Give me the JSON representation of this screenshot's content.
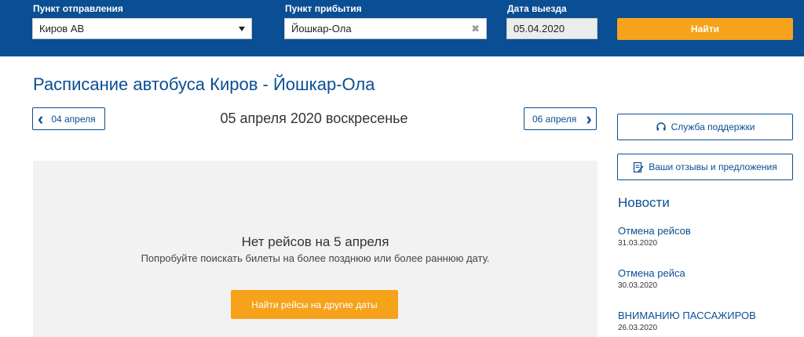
{
  "search": {
    "departure_label": "Пункт отправления",
    "departure_value": "Киров АВ",
    "arrival_label": "Пункт прибытия",
    "arrival_value": "Йошкар-Ола",
    "date_label": "Дата выезда",
    "date_value": "05.04.2020",
    "find_label": "Найти"
  },
  "page": {
    "title": "Расписание автобуса Киров - Йошкар-Ола",
    "prev_date": "04 апреля",
    "next_date": "06 апреля",
    "current_date": "05 апреля 2020 воскресенье"
  },
  "results": {
    "empty_title": "Нет рейсов на 5 апреля",
    "empty_hint": "Попробуйте поискать билеты на более позднюю или более раннюю дату.",
    "other_dates_label": "Найти рейсы на другие даты"
  },
  "sidebar": {
    "support_label": "Служба поддержки",
    "feedback_label": "Ваши отзывы и предложения",
    "news_title": "Новости",
    "news": [
      {
        "title": "Отмена рейсов",
        "date": "31.03.2020"
      },
      {
        "title": "Отмена рейса",
        "date": "30.03.2020"
      },
      {
        "title": "ВНИМАНИЮ ПАССАЖИРОВ",
        "date": "26.03.2020"
      }
    ]
  },
  "icons": {
    "support": "headset-icon",
    "feedback": "feedback-icon",
    "prev": "chevron-left-icon",
    "next": "chevron-right-icon",
    "select": "caret-down-icon",
    "clear": "close-icon"
  },
  "colors": {
    "header_bg": "#0a4e93",
    "accent": "#f7a21b",
    "panel_bg": "#f2f2f2"
  }
}
